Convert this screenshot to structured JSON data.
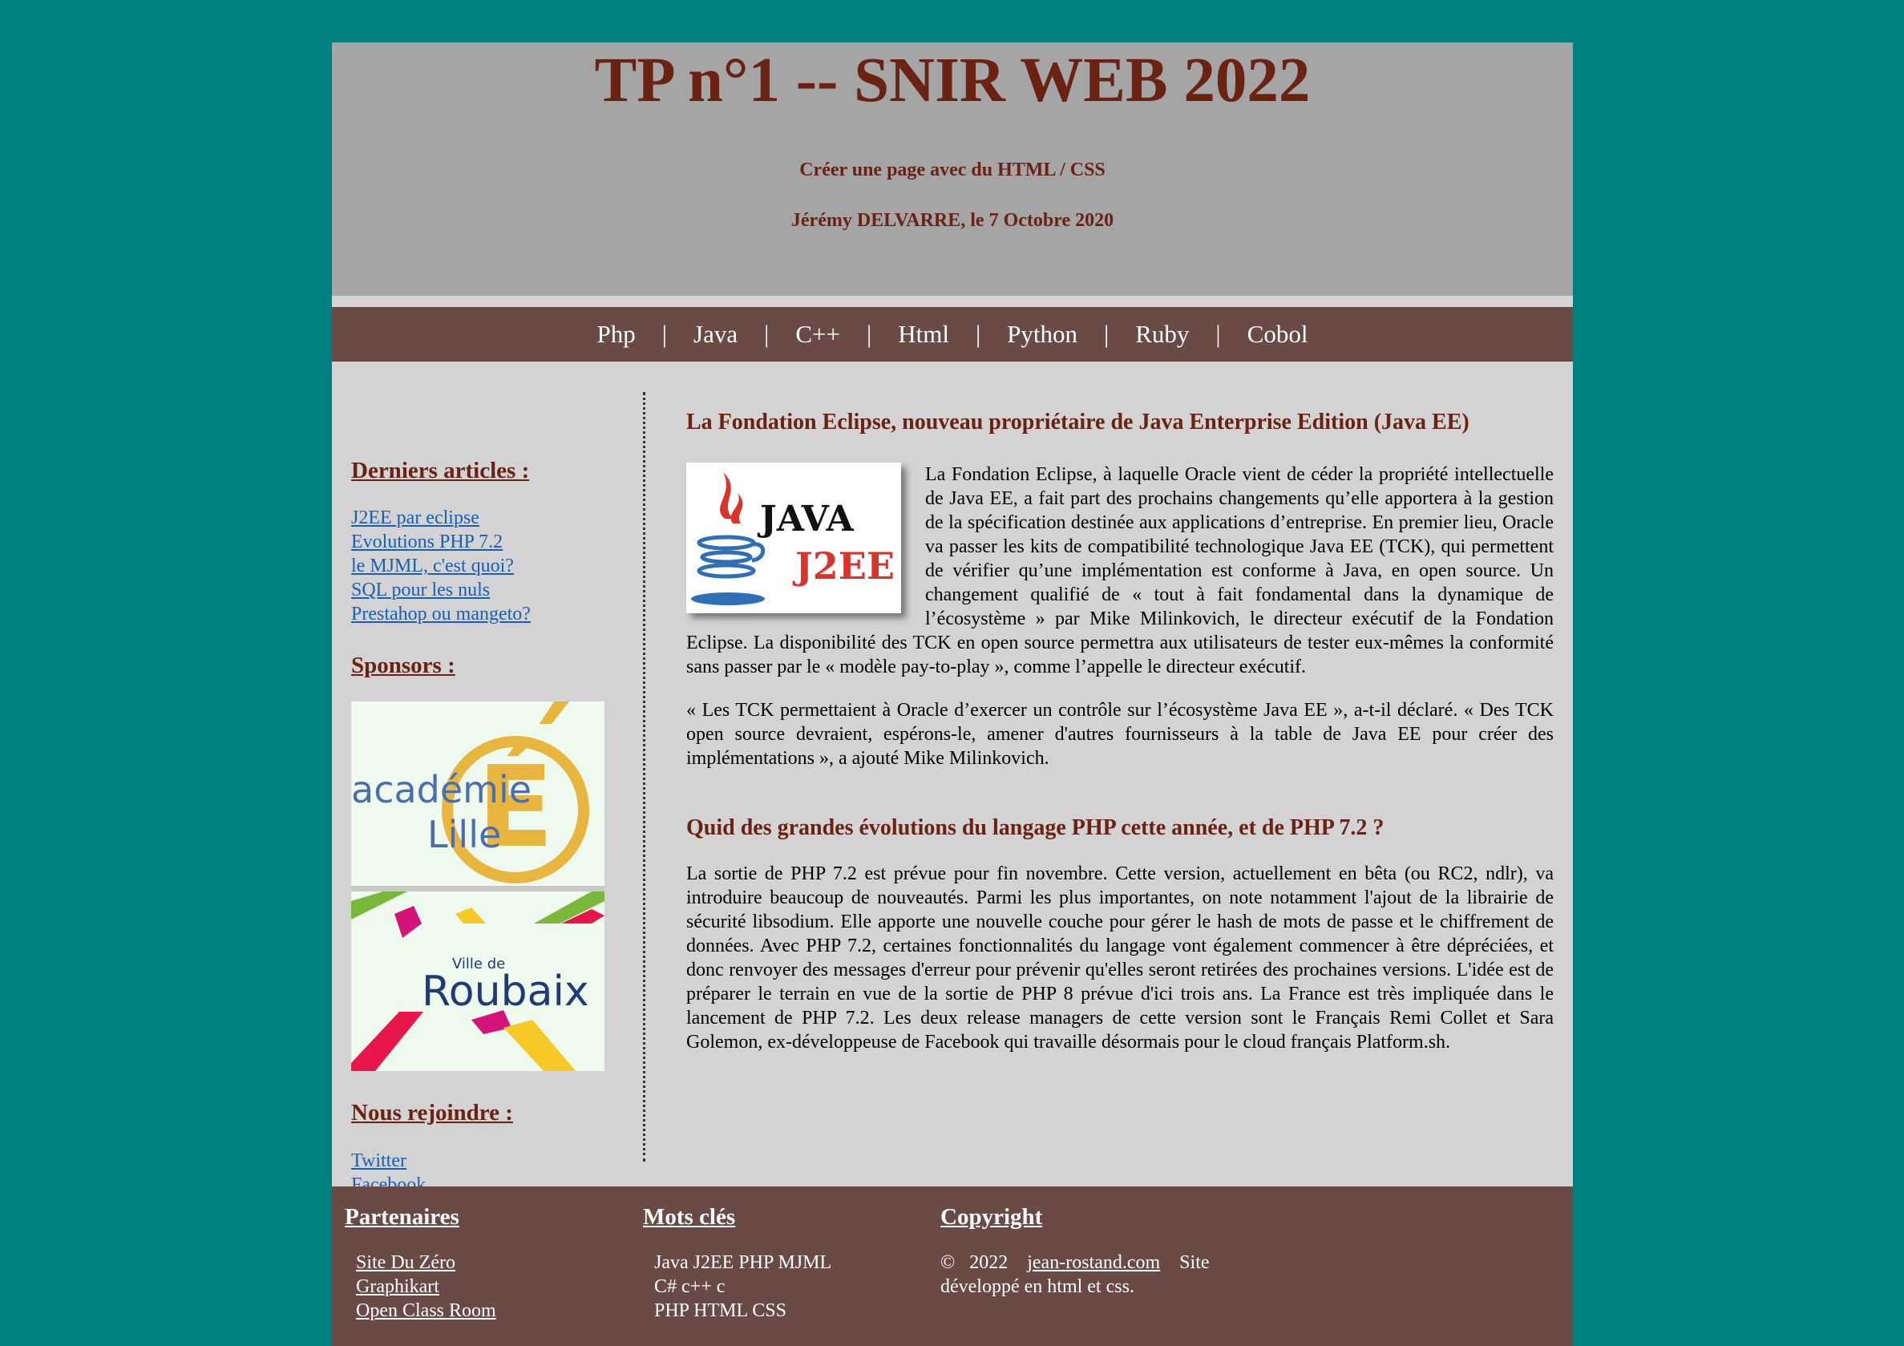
{
  "header": {
    "title": "TP n°1 -- SNIR WEB 2022",
    "subtitle": "Créer une page avec du HTML / CSS",
    "author": "Jérémy DELVARRE, le 7 Octobre 2020"
  },
  "nav": {
    "separator": "|",
    "items": [
      "Php",
      "Java",
      "C++",
      "Html",
      "Python",
      "Ruby",
      "Cobol"
    ]
  },
  "sidebar": {
    "articles_title": "Derniers articles :",
    "articles": [
      "J2EE par eclipse",
      "Evolutions PHP 7.2",
      "le MJML, c'est quoi?",
      "SQL pour les nuls",
      "Prestahop ou mangeto?"
    ],
    "sponsors_title": "Sponsors :",
    "sponsor1": {
      "line1": "académie",
      "line2": "Lille",
      "letter": "É"
    },
    "sponsor2": {
      "prefix": "Ville de",
      "name": "Roubaix"
    },
    "join_title": "Nous rejoindre :",
    "social": [
      "Twitter",
      "Facebook"
    ]
  },
  "main": {
    "article1": {
      "title": "La Fondation Eclipse, nouveau propriétaire de Java Enterprise Edition (Java EE)",
      "image_text1": "JAVA",
      "image_text2": "J2EE",
      "paragraph1": "La Fondation Eclipse, à laquelle Oracle vient de céder la propriété intellectuelle de Java EE, a fait part des prochains changements qu’elle apportera à la gestion de la spécification destinée aux applications d’entreprise. En premier lieu, Oracle va passer les kits de compatibilité technologique Java EE (TCK), qui permettent de vérifier qu’une implémentation est conforme à Java, en open source. Un changement qualifié de « tout à fait fondamental dans la dynamique de l’écosystème » par Mike Milinkovich, le directeur exécutif de la Fondation Eclipse. La disponibilité des TCK en open source permettra aux utilisateurs de tester eux-mêmes la conformité sans passer par le « modèle pay-to-play », comme l’appelle le directeur exécutif.",
      "paragraph2": "« Les TCK permettaient à Oracle d’exercer un contrôle sur l’écosystème Java EE », a-t-il déclaré. « Des TCK open source devraient, espérons-le, amener d'autres fournisseurs à la table de Java EE pour créer des implémentations », a ajouté Mike Milinkovich."
    },
    "article2": {
      "title": "Quid des grandes évolutions du langage PHP cette année, et de PHP 7.2 ?",
      "paragraph1": "La sortie de PHP 7.2 est prévue pour fin novembre. Cette version, actuellement en bêta (ou RC2, ndlr), va introduire beaucoup de nouveautés. Parmi les plus importantes, on note notamment l'ajout de la librairie de sécurité libsodium. Elle apporte une nouvelle couche pour gérer le hash de mots de passe et le chiffrement de données. Avec PHP 7.2, certaines fonctionnalités du langage vont également commencer à être dépréciées, et donc renvoyer des messages d'erreur pour prévenir qu'elles seront retirées des prochaines versions. L'idée est de préparer le terrain en vue de la sortie de PHP 8 prévue d'ici trois ans. La France est très impliquée dans le lancement de PHP 7.2. Les deux release managers de cette version sont le Français Remi Collet et Sara Golemon, ex-développeuse de Facebook qui travaille désormais pour le cloud français Platform.sh."
    }
  },
  "footer": {
    "partners_title": "Partenaires",
    "partners": [
      "Site Du Zéro",
      "Graphikart",
      "Open Class Room"
    ],
    "keywords_title": "Mots clés",
    "keywords": [
      "Java J2EE PHP MJML",
      "C# c++ c",
      "PHP HTML CSS"
    ],
    "copyright_title": "Copyright",
    "copyright_prefix": "©   2022",
    "copyright_link": "jean-rostand.com",
    "copyright_suffix": "Site",
    "copyright_line2": "développé en html et css."
  },
  "colors": {
    "page_background": "#008080",
    "header_background": "#a5a5a5",
    "nav_footer_background": "#6a4a45",
    "content_background": "#d3d3d3",
    "heading_color": "#6a2212",
    "link_color": "#1a5fb4"
  }
}
